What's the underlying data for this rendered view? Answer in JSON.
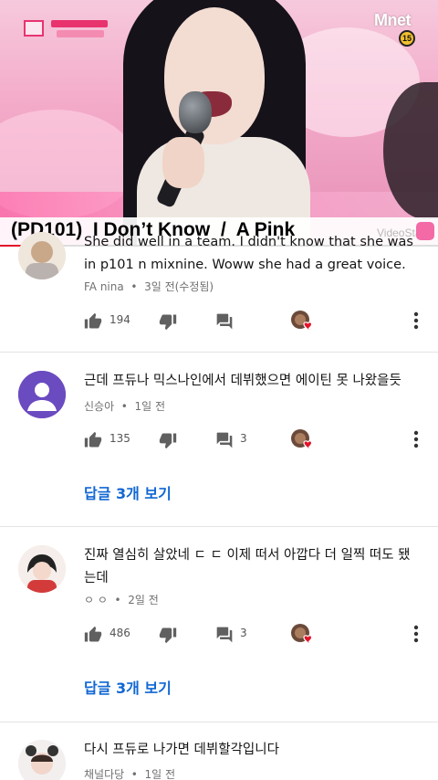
{
  "video": {
    "title": "(PD101)  I Don’t Know  /  A Pink",
    "channel_logo": "Mnet",
    "age_rating": "15",
    "watermark": "VideoStar",
    "progress_fraction": 0.11
  },
  "icons": {
    "like": "thumb-up-icon",
    "dislike": "thumb-down-icon",
    "reply": "comment-icon",
    "creator_heart": "creator-heart-icon",
    "more": "more-vert-icon"
  },
  "colors": {
    "link": "#1167d4",
    "heart": "#e3132a",
    "progress": "#e3132a"
  },
  "comments": [
    {
      "text": "She did well in a team. I didn't know that she was in p101 n mixnine. Woww she had a great voice.",
      "author": "FA nina",
      "time": "3일 전(수정됨)",
      "likes": "194",
      "replies": ""
    },
    {
      "text": "근데 프듀나 믹스나인에서 데뷔했으면 에이틴 못 나왔을듯",
      "author": "신승아",
      "time": "1일 전",
      "likes": "135",
      "replies": "3",
      "view_replies": "답글 3개 보기"
    },
    {
      "text": "진짜 열심히 살았네 ㄷ ㄷ 이제 떠서 아깝다 더 일찍 떠도 됐는데",
      "author": "ㅇ ㅇ",
      "time": "2일 전",
      "likes": "486",
      "replies": "3",
      "view_replies": "답글 3개 보기"
    },
    {
      "text": "다시 프듀로 나가면 데뷔할각입니다",
      "author": "채널다당",
      "time": "1일 전",
      "likes": "",
      "replies": ""
    }
  ]
}
